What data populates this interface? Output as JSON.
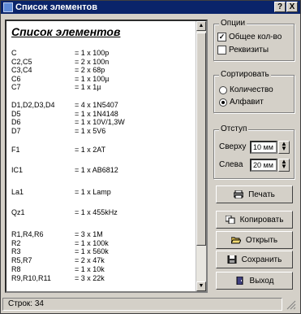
{
  "window": {
    "title": "Список элементов"
  },
  "titlebar_buttons": {
    "help": "?",
    "close": "X"
  },
  "list": {
    "title": "Список элементов",
    "rows": [
      {
        "ref": "C",
        "value": "= 1 x 100p"
      },
      {
        "ref": "C2,C5",
        "value": "= 2 x 100n"
      },
      {
        "ref": "C3,C4",
        "value": "= 2 x 68p"
      },
      {
        "ref": "C6",
        "value": "= 1 x 100µ"
      },
      {
        "ref": "C7",
        "value": "= 1 x 1µ"
      },
      {
        "ref": "D1,D2,D3,D4",
        "value": "= 4 x 1N5407"
      },
      {
        "ref": "D5",
        "value": "= 1 x 1N4148"
      },
      {
        "ref": "D6",
        "value": "= 1 x 10V/1,3W"
      },
      {
        "ref": "D7",
        "value": "= 1 x 5V6"
      },
      {
        "ref": "F1",
        "value": "= 1 x 2AT"
      },
      {
        "ref": "IC1",
        "value": "= 1 x AB6812"
      },
      {
        "ref": "La1",
        "value": "= 1 x Lamp"
      },
      {
        "ref": "Qz1",
        "value": "= 1 x 455kHz"
      },
      {
        "ref": "R1,R4,R6",
        "value": "= 3 x 1M"
      },
      {
        "ref": "R2",
        "value": "= 1 x 100k"
      },
      {
        "ref": "R3",
        "value": "= 1 x 560k"
      },
      {
        "ref": "R5,R7",
        "value": "= 2 x 47k"
      },
      {
        "ref": "R8",
        "value": "= 1 x 10k"
      },
      {
        "ref": "R9,R10,R11",
        "value": "= 3 x 22k"
      }
    ]
  },
  "options": {
    "label": "Опции",
    "total_count": {
      "label": "Общее кол-во",
      "checked": true
    },
    "props": {
      "label": "Реквизиты",
      "checked": false
    }
  },
  "sort": {
    "label": "Сортировать",
    "by_count": {
      "label": "Количество",
      "selected": false
    },
    "alpha": {
      "label": "Алфавит",
      "selected": true
    }
  },
  "indent": {
    "label": "Отступ",
    "top": {
      "label": "Сверху",
      "value": "10 мм"
    },
    "left": {
      "label": "Слева",
      "value": "20 мм"
    }
  },
  "buttons": {
    "print": "Печать",
    "copy": "Копировать",
    "open": "Открыть",
    "save": "Сохранить",
    "exit": "Выход"
  },
  "status": {
    "text": "Строк: 34"
  }
}
